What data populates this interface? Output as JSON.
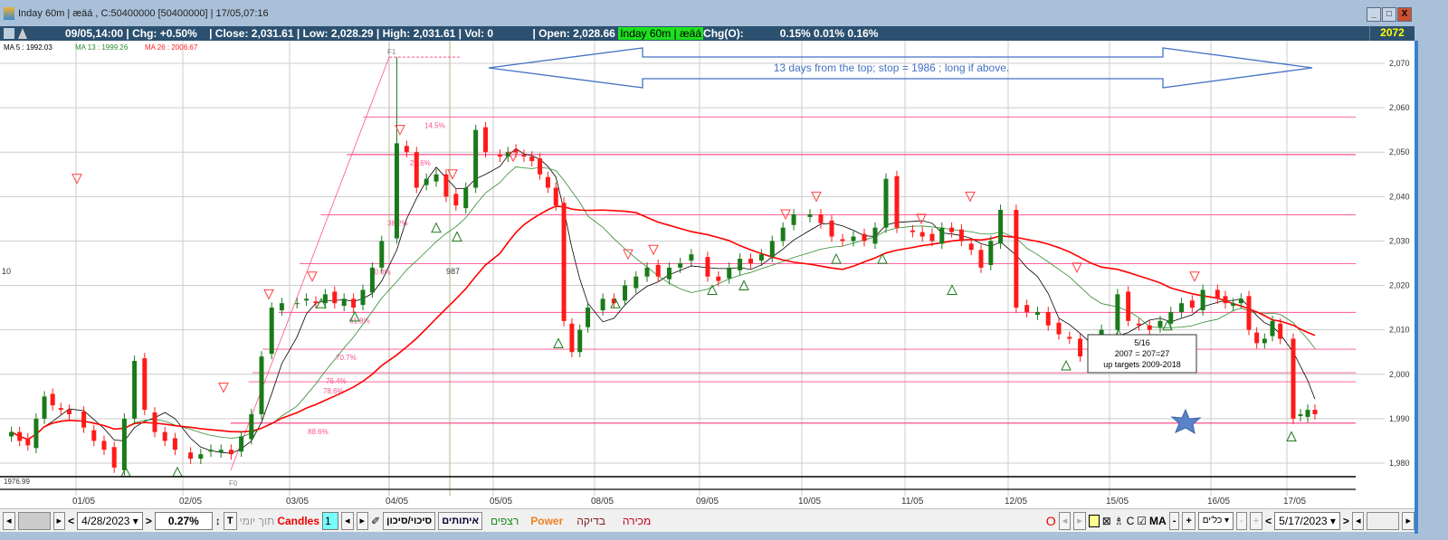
{
  "window": {
    "title": "Inday 60m | æäá , C:50400000 [50400000] | 17/05,07:16",
    "minimize": "_",
    "maximize": "□",
    "close": "X"
  },
  "infobar": {
    "text": "09/05,14:00 | Chg: +0.50%    | Close: 2,031.61 | Low: 2,028.29 | High: 2,031.61 | Vol: 0",
    "open": "             | Open: 2,028.66 ",
    "badge": "Inday 60m | æäá",
    "chg_label": "Chg(O):",
    "chg_values": "            0.15% 0.01% 0.16%",
    "last_price": "2072"
  },
  "legend": {
    "ma5": "MA 5 : 1992.03",
    "ma13": "MA 13 : 1999.26",
    "ma26": "MA 26 : 2006.67"
  },
  "colors": {
    "ma5": "#000000",
    "ma13": "#2e8b2e",
    "ma26": "#ff0000",
    "up": "#1a7a1a",
    "down": "#ff1a1a",
    "fib": "#ff4f8f",
    "arrow": "#4472c4"
  },
  "chart_data": {
    "type": "candlestick",
    "y_axis": {
      "ticks": [
        1980,
        1990,
        2000,
        2010,
        2020,
        2030,
        2040,
        2050,
        2060,
        2070
      ],
      "labels": [
        "1,980",
        "1,990",
        "2,000",
        "2,010",
        "2,020",
        "2,030",
        "2,040",
        "2,050",
        "2,060",
        "2,070"
      ]
    },
    "x_labels": [
      "01/05",
      "02/05",
      "03/05",
      "04/05",
      "05/05",
      "08/05",
      "09/05",
      "10/05",
      "11/05",
      "12/05",
      "15/05",
      "16/05",
      "17/05"
    ],
    "days": [
      {
        "closes": [
          1987,
          1985,
          1984,
          1990,
          1995,
          1993,
          1992,
          1991
        ]
      },
      {
        "closes": [
          1988,
          1985,
          1983,
          1979,
          1990,
          2003,
          1992,
          1987,
          1985,
          1983
        ]
      },
      {
        "closes": [
          1981,
          1982,
          1983,
          1983,
          1982,
          1986,
          1991,
          2004,
          2015,
          2016
        ]
      },
      {
        "closes": [
          2016,
          2017,
          2016,
          2018,
          2016,
          2017,
          2015,
          2019,
          2024,
          2030
        ]
      },
      {
        "closes": [
          2052,
          2050,
          2042,
          2044,
          2045,
          2040,
          2038,
          2042,
          2055,
          2050
        ]
      },
      {
        "closes": [
          2049,
          2050,
          2050,
          2049,
          2048,
          2045,
          2042,
          2038,
          2012,
          2005,
          2010,
          2015
        ]
      },
      {
        "closes": [
          2017,
          2016,
          2020,
          2022,
          2024,
          2022,
          2024,
          2025,
          2027
        ]
      },
      {
        "closes": [
          2022,
          2021,
          2024,
          2026,
          2025,
          2027,
          2030,
          2033,
          2036
        ]
      },
      {
        "closes": [
          2036,
          2034,
          2031,
          2030,
          2031,
          2030,
          2033,
          2044,
          2033
        ]
      },
      {
        "closes": [
          2032,
          2031,
          2030,
          2033,
          2032,
          2030,
          2028,
          2024,
          2030,
          2037
        ]
      },
      {
        "closes": [
          2015,
          2014,
          2014,
          2011,
          2009,
          2008,
          2004,
          2003,
          2010
        ]
      },
      {
        "closes": [
          2018,
          2012,
          2011,
          2010,
          2012,
          2014,
          2016,
          2015,
          2019
        ]
      },
      {
        "closes": [
          2017,
          2016,
          2016,
          2017,
          2010,
          2007,
          2008,
          2012,
          2008
        ]
      },
      {
        "closes": [
          1990,
          1991,
          1992,
          1991
        ]
      }
    ],
    "spike_high": 2071.4,
    "fib": {
      "high": 2071.4,
      "low": 1978.4,
      "levels": [
        {
          "pct": 0.145,
          "label": "14.5%"
        },
        {
          "pct": 0.236,
          "label": "23.6%"
        },
        {
          "pct": 0.382,
          "label": "38.2%"
        },
        {
          "pct": 0.5,
          "label": "50.0%"
        },
        {
          "pct": 0.618,
          "label": "61.8%"
        },
        {
          "pct": 0.707,
          "label": "70.7%"
        },
        {
          "pct": 0.764,
          "label": "76.4%"
        },
        {
          "pct": 0.786,
          "label": "78.6%"
        },
        {
          "pct": 0.886,
          "label": "88.6%"
        }
      ],
      "top_label": "F1",
      "bottom_label": "F0"
    },
    "moving_averages": [
      5,
      13,
      26
    ]
  },
  "annotations": {
    "arrow_text": "13 days from the top; stop = 1986 ; long if above.",
    "box_line1": "5/16",
    "box_line2": "2007 = 207=27",
    "box_line3": "up targets 2009-2018",
    "left_value": "1976.99",
    "left_mark": "10",
    "mark_987": "987"
  },
  "toolbar": {
    "date_from": "4/28/2023",
    "pct": "0.27%",
    "t": "T",
    "intraday": "תוך יומי",
    "candles": "Candles",
    "candles_count": "1",
    "risk": "סיכוי/סיכון",
    "signals": "איתותים",
    "sequences": "רצפים",
    "power": "Power",
    "check": "בדיקה",
    "sell": "מכירה",
    "o": "O",
    "c": "C",
    "ma": "MA",
    "minus": "-",
    "plus": "+",
    "tools": "כל'ים",
    "date_to": "5/17/2023",
    "prev": "<",
    "next": ">"
  }
}
